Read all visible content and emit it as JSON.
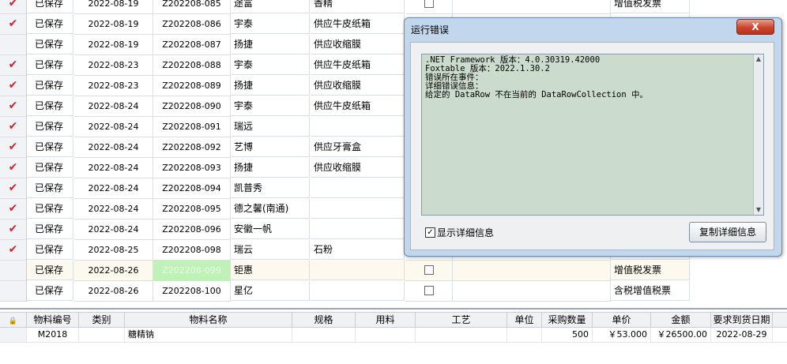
{
  "top_grid": {
    "rows": [
      {
        "checked": true,
        "status": "已保存",
        "date": "2022-08-19",
        "no": "Z202208-085",
        "supplier": "途富",
        "item": "香精",
        "inv_checkbox": true,
        "invoice": "增值税发票"
      },
      {
        "checked": true,
        "status": "已保存",
        "date": "2022-08-19",
        "no": "Z202208-086",
        "supplier": "宇泰",
        "item": "供应牛皮纸箱",
        "inv_checkbox": false,
        "invoice": ""
      },
      {
        "checked": false,
        "status": "已保存",
        "date": "2022-08-19",
        "no": "Z202208-087",
        "supplier": "扬捷",
        "item": "供应收缩膜",
        "inv_checkbox": false,
        "invoice": ""
      },
      {
        "checked": true,
        "status": "已保存",
        "date": "2022-08-23",
        "no": "Z202208-088",
        "supplier": "宇泰",
        "item": "供应牛皮纸箱",
        "inv_checkbox": false,
        "invoice": ""
      },
      {
        "checked": true,
        "status": "已保存",
        "date": "2022-08-23",
        "no": "Z202208-089",
        "supplier": "扬捷",
        "item": "供应收缩膜",
        "inv_checkbox": false,
        "invoice": ""
      },
      {
        "checked": true,
        "status": "已保存",
        "date": "2022-08-24",
        "no": "Z202208-090",
        "supplier": "宇泰",
        "item": "供应牛皮纸箱",
        "inv_checkbox": false,
        "invoice": ""
      },
      {
        "checked": true,
        "status": "已保存",
        "date": "2022-08-24",
        "no": "Z202208-091",
        "supplier": "瑞远",
        "item": "",
        "inv_checkbox": false,
        "invoice": ""
      },
      {
        "checked": true,
        "status": "已保存",
        "date": "2022-08-24",
        "no": "Z202208-092",
        "supplier": "艺博",
        "item": "供应牙膏盒",
        "inv_checkbox": false,
        "invoice": ""
      },
      {
        "checked": true,
        "status": "已保存",
        "date": "2022-08-24",
        "no": "Z202208-093",
        "supplier": "扬捷",
        "item": "供应收缩膜",
        "inv_checkbox": false,
        "invoice": ""
      },
      {
        "checked": true,
        "status": "已保存",
        "date": "2022-08-24",
        "no": "Z202208-094",
        "supplier": "凯普秀",
        "item": "",
        "inv_checkbox": false,
        "invoice": ""
      },
      {
        "checked": true,
        "status": "已保存",
        "date": "2022-08-24",
        "no": "Z202208-095",
        "supplier": "德之馨(南通)",
        "item": "",
        "inv_checkbox": false,
        "invoice": ""
      },
      {
        "checked": true,
        "status": "已保存",
        "date": "2022-08-24",
        "no": "Z202208-096",
        "supplier": "安徽一帆",
        "item": "",
        "inv_checkbox": false,
        "invoice": ""
      },
      {
        "checked": true,
        "status": "已保存",
        "date": "2022-08-25",
        "no": "Z202208-098",
        "supplier": "瑞云",
        "item": "石粉",
        "inv_checkbox": false,
        "invoice": ""
      },
      {
        "checked": false,
        "status": "已保存",
        "date": "2022-08-26",
        "no": "Z202208-099",
        "supplier": "钜惠",
        "item": "",
        "inv_checkbox": true,
        "invoice": "增值税发票"
      },
      {
        "checked": false,
        "status": "已保存",
        "date": "2022-08-26",
        "no": "Z202208-100",
        "supplier": "星亿",
        "item": "",
        "inv_checkbox": true,
        "invoice": "含税增值税票"
      }
    ]
  },
  "bottom_grid": {
    "headers": [
      "物料编号",
      "类别",
      "物料名称",
      "规格",
      "用料",
      "工艺",
      "单位",
      "采购数量",
      "单价",
      "金额",
      "要求到货日期"
    ],
    "rows": [
      {
        "code": "M2018",
        "category": "",
        "name": "糖精钠",
        "spec": "",
        "material": "",
        "process": "",
        "unit": "",
        "qty": "500",
        "price": "￥53.000",
        "amount": "￥26500.00",
        "due": "2022-08-29"
      }
    ]
  },
  "dialog": {
    "title": "运行错误",
    "close_label": "X",
    "message_lines": [
      ".NET Framework 版本：4.0.30319.42000",
      "Foxtable 版本：2022.1.30.2",
      "错误所在事件：",
      "详细错误信息：",
      "给定的 DataRow 不在当前的 DataRowCollection 中。"
    ],
    "show_detail_label": "显示详细信息",
    "show_detail_checked": true,
    "copy_button_label": "复制详细信息"
  }
}
